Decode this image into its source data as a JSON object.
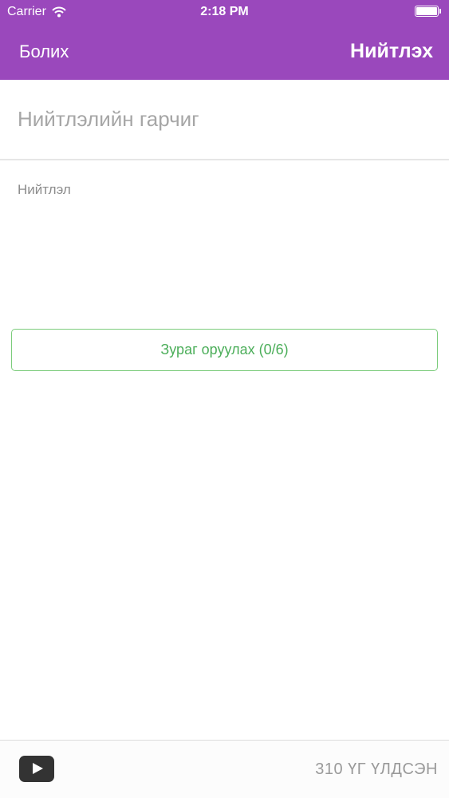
{
  "status_bar": {
    "carrier": "Carrier",
    "time": "2:18 PM"
  },
  "nav": {
    "cancel_label": "Болих",
    "publish_label": "Нийтлэх"
  },
  "form": {
    "title_placeholder": "Нийтлэлийн гарчиг",
    "title_value": "",
    "body_placeholder": "Нийтлэл",
    "body_value": "",
    "add_image_label": "Зураг оруулах (0/6)"
  },
  "footer": {
    "words_left": "310 ҮГ ҮЛДСЭН"
  },
  "colors": {
    "header_bg": "#9a48bc",
    "accent_green": "#4cae5a"
  },
  "icons": {
    "wifi": "wifi-icon",
    "battery": "battery-icon",
    "video": "play-icon"
  }
}
